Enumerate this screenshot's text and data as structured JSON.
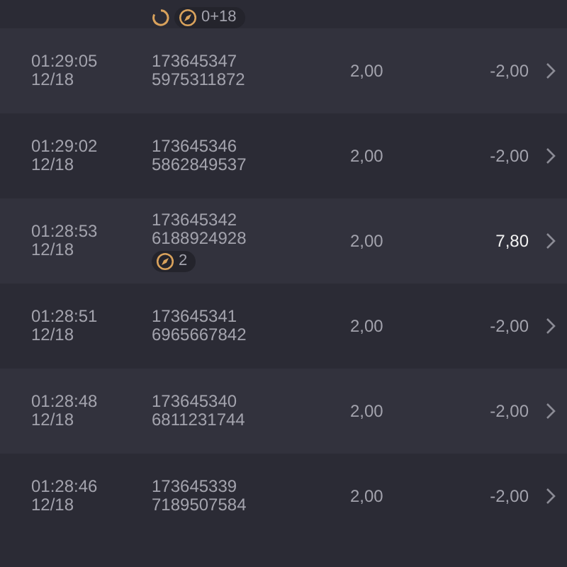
{
  "top_row": {
    "tags": [
      {
        "kind": "spinner"
      },
      {
        "kind": "bonus",
        "text": "0+18"
      }
    ]
  },
  "rows": [
    {
      "time": "01:29:05",
      "date": "12/18",
      "id": "173645347",
      "ref": "5975311872",
      "stake": "2,00",
      "result": "-2,00",
      "won": false,
      "tags": []
    },
    {
      "time": "01:29:02",
      "date": "12/18",
      "id": "173645346",
      "ref": "5862849537",
      "stake": "2,00",
      "result": "-2,00",
      "won": false,
      "tags": []
    },
    {
      "time": "01:28:53",
      "date": "12/18",
      "id": "173645342",
      "ref": "6188924928",
      "stake": "2,00",
      "result": "7,80",
      "won": true,
      "tags": [
        {
          "kind": "bonus",
          "text": "2"
        }
      ]
    },
    {
      "time": "01:28:51",
      "date": "12/18",
      "id": "173645341",
      "ref": "6965667842",
      "stake": "2,00",
      "result": "-2,00",
      "won": false,
      "tags": []
    },
    {
      "time": "01:28:48",
      "date": "12/18",
      "id": "173645340",
      "ref": "6811231744",
      "stake": "2,00",
      "result": "-2,00",
      "won": false,
      "tags": []
    },
    {
      "time": "01:28:46",
      "date": "12/18",
      "id": "173645339",
      "ref": "7189507584",
      "stake": "2,00",
      "result": "-2,00",
      "won": false,
      "tags": []
    }
  ]
}
